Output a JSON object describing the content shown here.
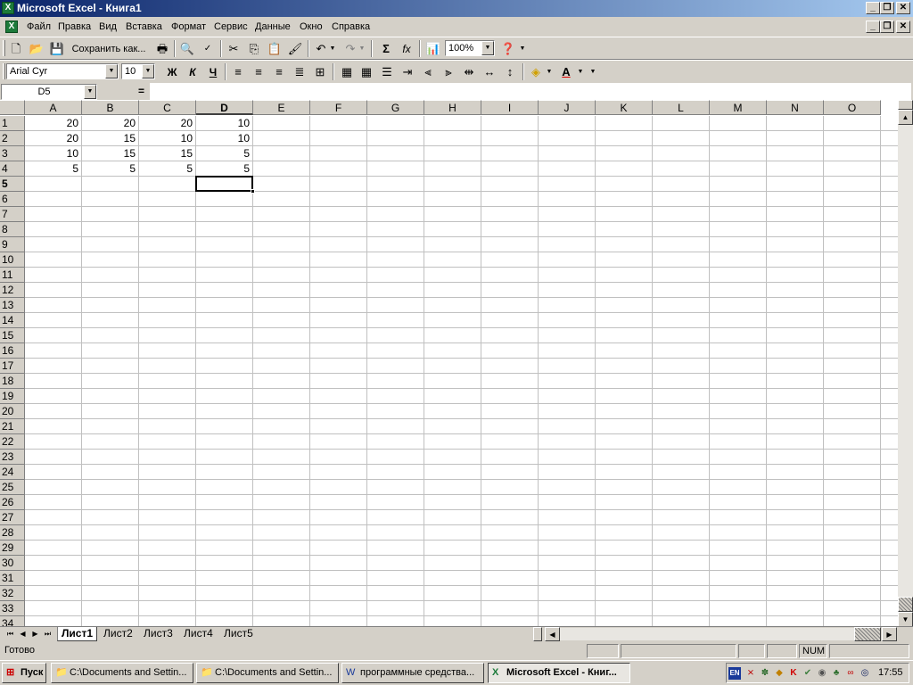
{
  "window": {
    "title": "Microsoft Excel - Книга1"
  },
  "menu": [
    "Файл",
    "Правка",
    "Вид",
    "Вставка",
    "Формат",
    "Сервис",
    "Данные",
    "Окно",
    "Справка"
  ],
  "toolbar": {
    "save_as_label": "Сохранить как...",
    "zoom": "100%"
  },
  "format": {
    "font": "Arial Cyr",
    "size": "10",
    "bold": "Ж",
    "italic": "К",
    "underline": "Ч"
  },
  "formula": {
    "name_box": "D5",
    "equals": "=",
    "value": ""
  },
  "grid": {
    "columns": [
      "A",
      "B",
      "C",
      "D",
      "E",
      "F",
      "G",
      "H",
      "I",
      "J",
      "K",
      "L",
      "M",
      "N",
      "O"
    ],
    "rows": [
      "1",
      "2",
      "3",
      "4",
      "5",
      "6",
      "7",
      "8",
      "9",
      "10",
      "11",
      "12",
      "13",
      "14",
      "15",
      "16",
      "17",
      "18",
      "19",
      "20",
      "21",
      "22",
      "23",
      "24",
      "25",
      "26",
      "27",
      "28",
      "29",
      "30",
      "31",
      "32",
      "33",
      "34"
    ],
    "active_cell": "D5",
    "cells": [
      [
        "20",
        "20",
        "20",
        "10"
      ],
      [
        "20",
        "15",
        "10",
        "10"
      ],
      [
        "10",
        "15",
        "15",
        "5"
      ],
      [
        "5",
        "5",
        "5",
        "5"
      ]
    ]
  },
  "sheets": [
    "Лист1",
    "Лист2",
    "Лист3",
    "Лист4",
    "Лист5"
  ],
  "status": {
    "ready": "Готово",
    "num": "NUM"
  },
  "taskbar": {
    "start": "Пуск",
    "buttons": [
      "C:\\Documents and Settin...",
      "C:\\Documents and Settin...",
      "программные средства...",
      "Microsoft Excel - Книг..."
    ],
    "clock": "17:55",
    "lang": "EN"
  }
}
